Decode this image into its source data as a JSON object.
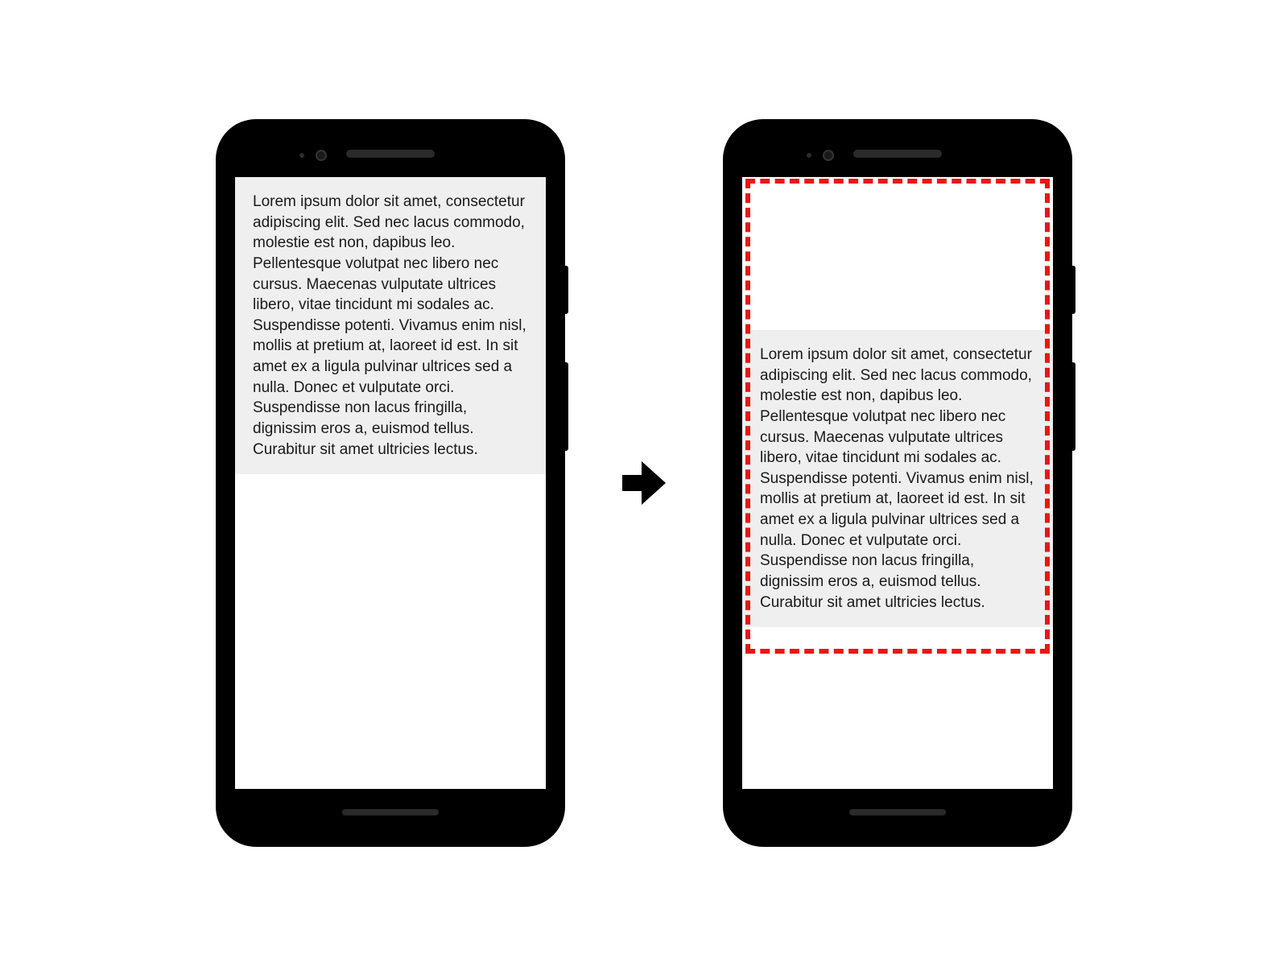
{
  "lorem_text": "Lorem ipsum dolor sit amet, consectetur adipiscing elit. Sed nec lacus commodo, molestie est non, dapibus leo. Pellentesque volutpat nec libero nec cursus. Maecenas vulputate ultrices libero, vitae tincidunt mi sodales ac. Suspendisse potenti. Vivamus enim nisl, mollis at pretium at, laoreet id est. In sit amet ex a ligula pulvinar ultrices sed a nulla. Donec et vulputate orci. Suspendisse non lacus fringilla, dignissim eros a, euismod tellus. Curabitur sit amet ultricies lectus.",
  "highlight_color": "#e81616"
}
